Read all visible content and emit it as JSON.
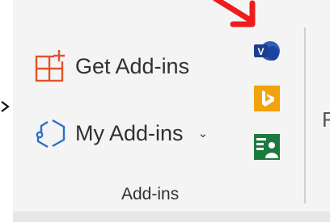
{
  "addins": {
    "get_addins_label": "Get Add-ins",
    "my_addins_label": "My Add-ins",
    "group_label": "Add-ins",
    "right_cut_text": "F"
  },
  "colors": {
    "accent_orange": "#e0532b",
    "accent_blue": "#2b6fc9",
    "annotation_red": "#ee1c1c",
    "bing_orange": "#f2a20d",
    "green_app": "#1d7a3f"
  },
  "icons": {
    "get_addins": "store-grid-plus-icon",
    "my_addins": "puzzle-hexagon-icon",
    "dropdown": "chevron-down-icon",
    "viva": "viva-insights-icon",
    "bing": "bing-icon",
    "people": "contact-card-icon"
  }
}
